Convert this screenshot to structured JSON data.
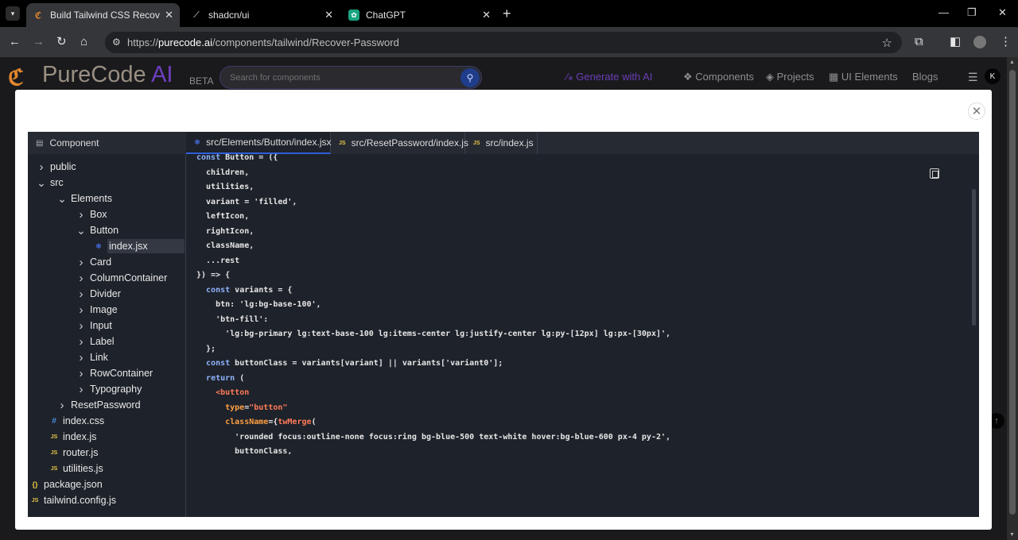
{
  "browser": {
    "tabs": [
      {
        "title": "Build Tailwind CSS Recover Pass",
        "icon": "purecode-icon",
        "active": true
      },
      {
        "title": "shadcn/ui",
        "icon": "shadcn-icon",
        "active": false
      },
      {
        "title": "ChatGPT",
        "icon": "chatgpt-icon",
        "active": false
      }
    ],
    "url_prefix": "https://",
    "url_host": "purecode.ai",
    "url_path": "/components/tailwind/Recover-Password"
  },
  "site": {
    "logo_text": "PureCode",
    "logo_ai": "AI",
    "beta": "BETA",
    "search_placeholder": "Search for components",
    "nav": {
      "generate": "Generate with AI",
      "components": "Components",
      "projects": "Projects",
      "ui_elements": "UI Elements",
      "blogs": "Blogs"
    },
    "avatar_letter": "K"
  },
  "explorer": {
    "header": "Component",
    "items": [
      {
        "label": "public",
        "kind": "folder",
        "open": false
      },
      {
        "label": "src",
        "kind": "folder",
        "open": true
      },
      {
        "label": "Elements",
        "kind": "folder",
        "open": true
      },
      {
        "label": "Box",
        "kind": "folder",
        "open": false
      },
      {
        "label": "Button",
        "kind": "folder",
        "open": true
      },
      {
        "label": "index.jsx",
        "kind": "jsx",
        "selected": true
      },
      {
        "label": "Card",
        "kind": "folder",
        "open": false
      },
      {
        "label": "ColumnContainer",
        "kind": "folder",
        "open": false
      },
      {
        "label": "Divider",
        "kind": "folder",
        "open": false
      },
      {
        "label": "Image",
        "kind": "folder",
        "open": false
      },
      {
        "label": "Input",
        "kind": "folder",
        "open": false
      },
      {
        "label": "Label",
        "kind": "folder",
        "open": false
      },
      {
        "label": "Link",
        "kind": "folder",
        "open": false
      },
      {
        "label": "RowContainer",
        "kind": "folder",
        "open": false
      },
      {
        "label": "Typography",
        "kind": "folder",
        "open": false
      },
      {
        "label": "ResetPassword",
        "kind": "folder",
        "open": false
      },
      {
        "label": "index.css",
        "kind": "css"
      },
      {
        "label": "index.js",
        "kind": "js"
      },
      {
        "label": "router.js",
        "kind": "js"
      },
      {
        "label": "utilities.js",
        "kind": "js"
      },
      {
        "label": "package.json",
        "kind": "json"
      },
      {
        "label": "tailwind.config.js",
        "kind": "js"
      }
    ]
  },
  "file_tabs": [
    {
      "label": "src/Elements/Button/index.jsx",
      "kind": "jsx"
    },
    {
      "label": "src/ResetPassword/index.js",
      "kind": "js"
    },
    {
      "label": "src/index.js",
      "kind": "js"
    }
  ],
  "code_lines": [
    "const Button = ({",
    "  children,",
    "  utilities,",
    "  variant = 'filled',",
    "  leftIcon,",
    "  rightIcon,",
    "  className,",
    "  ...rest",
    "}) => {",
    "  const variants = {",
    "    btn: 'lg:bg-base-100',",
    "    'btn-fill':",
    "      'lg:bg-primary lg:text-base-100 lg:items-center lg:justify-center lg:py-[12px] lg:px-[30px]',",
    "  };",
    "  const buttonClass = variants[variant] || variants['variant0'];",
    "  return (",
    "    <button",
    "      type=\"button\"",
    "      className={twMerge(",
    "        'rounded focus:outline-none focus:ring bg-blue-500 text-white hover:bg-blue-600 px-4 py-2',",
    "        buttonClass,"
  ]
}
